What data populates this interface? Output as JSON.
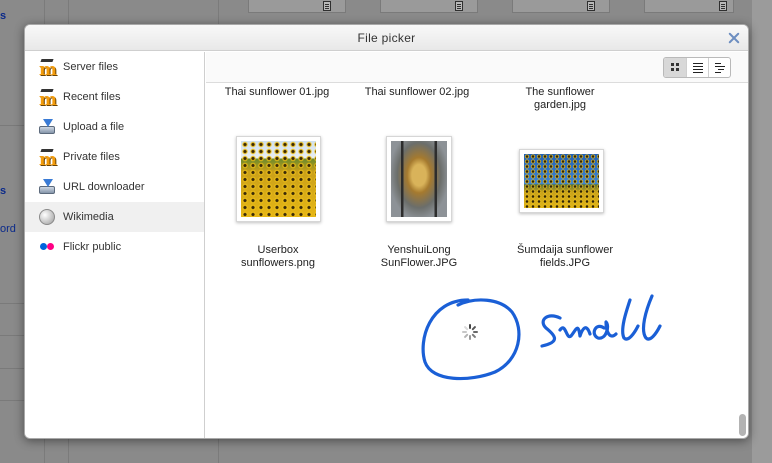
{
  "background": {
    "links": [
      "s",
      "s",
      "ord"
    ]
  },
  "dialog": {
    "title": "File picker",
    "close_icon": "close-icon"
  },
  "sidebar": {
    "items": [
      {
        "label": "Server files",
        "icon": "moodle-icon",
        "active": false
      },
      {
        "label": "Recent files",
        "icon": "moodle-icon",
        "active": false
      },
      {
        "label": "Upload a file",
        "icon": "upload-icon",
        "active": false
      },
      {
        "label": "Private files",
        "icon": "moodle-icon",
        "active": false
      },
      {
        "label": "URL downloader",
        "icon": "download-icon",
        "active": false
      },
      {
        "label": "Wikimedia",
        "icon": "wikimedia-globe-icon",
        "active": true
      },
      {
        "label": "Flickr public",
        "icon": "flickr-icon",
        "active": false
      }
    ]
  },
  "toolbar": {
    "views": [
      {
        "name": "icon-view",
        "icon": "grid-icon",
        "selected": true
      },
      {
        "name": "list-view",
        "icon": "list-icon",
        "selected": false
      },
      {
        "name": "tree-view",
        "icon": "tree-icon",
        "selected": false
      }
    ]
  },
  "files": {
    "row1": [
      {
        "name": "Thai sunflower 01.jpg"
      },
      {
        "name": "Thai sunflower 02.jpg"
      },
      {
        "name": "The sunflower garden.jpg"
      }
    ],
    "row2": [
      {
        "name": "Userbox sunflowers.png"
      },
      {
        "name": "YenshuiLong SunFlower.JPG"
      },
      {
        "name": "Šumdaija sunflower fields.JPG"
      }
    ]
  },
  "colors": {
    "annotation_ink": "#1a5fd6",
    "close_icon": "#6d8ec0",
    "active_item_bg": "#f0f0f0"
  }
}
